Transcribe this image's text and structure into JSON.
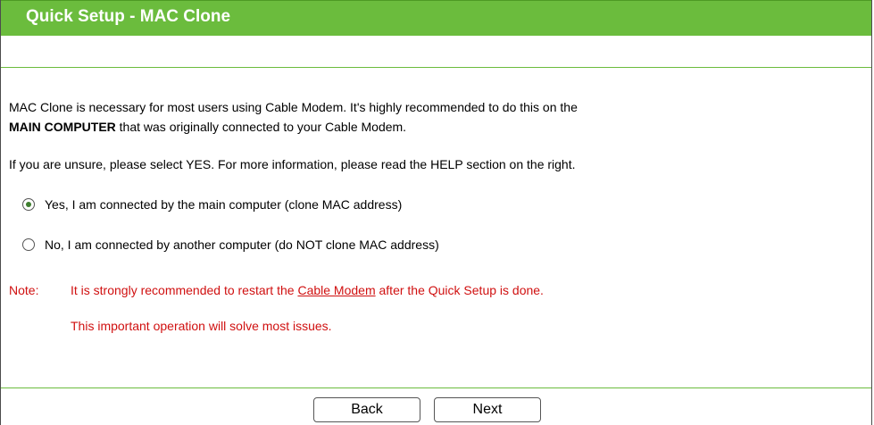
{
  "header": {
    "title": "Quick Setup - MAC Clone"
  },
  "intro": {
    "line1": "MAC Clone is necessary for most users using Cable Modem. It's highly recommended to do this on the",
    "line2_bold": "MAIN COMPUTER",
    "line2_rest": " that was originally connected to your Cable Modem.",
    "line3": "If you are unsure, please select YES. For more information, please read the HELP section on the right."
  },
  "options": [
    {
      "label": "Yes, I am connected by the main computer (clone MAC address)",
      "selected": true
    },
    {
      "label": "No, I am connected by another computer (do NOT clone MAC address)",
      "selected": false
    }
  ],
  "note": {
    "label": "Note:",
    "text_before": "It is strongly recommended to restart the ",
    "link": "Cable Modem",
    "text_after": " after the Quick Setup is done.",
    "line2": "This important operation will solve most issues."
  },
  "buttons": {
    "back": "Back",
    "next": "Next"
  },
  "colors": {
    "header_green": "#6bbc3d",
    "note_red": "#d01010"
  }
}
